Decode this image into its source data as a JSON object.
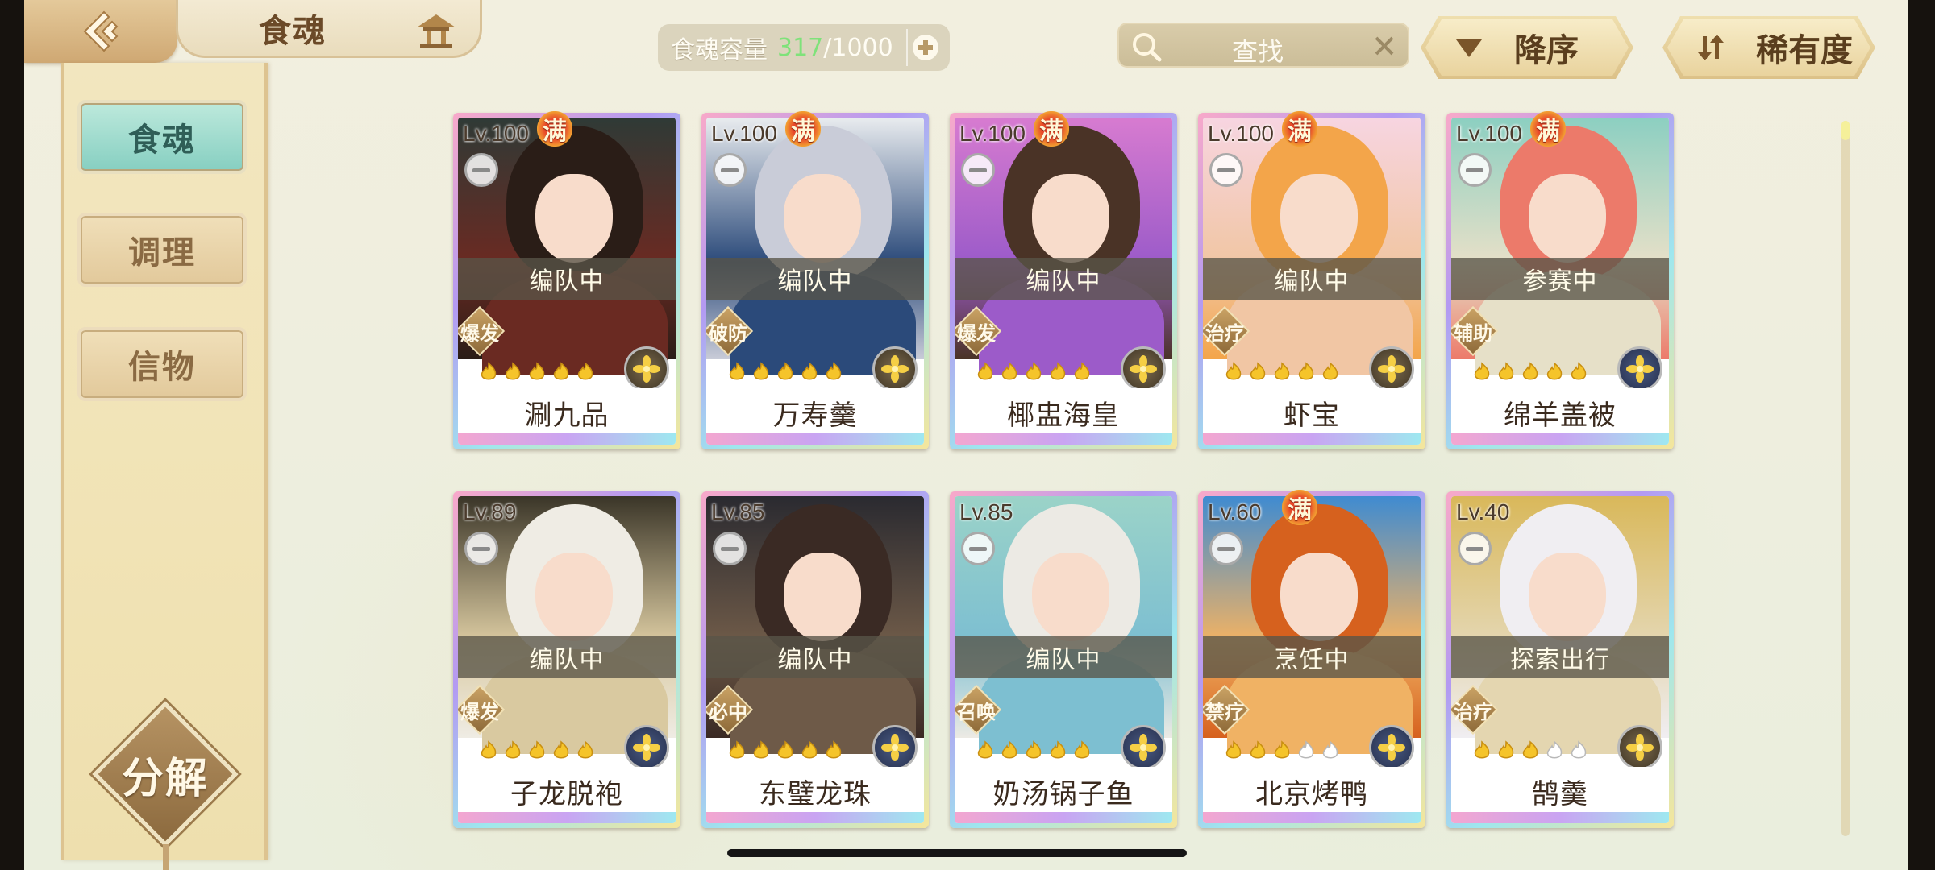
{
  "header": {
    "title": "食魂",
    "capacity_label": "食魂容量",
    "capacity_current": "317",
    "capacity_max": "/1000",
    "search_placeholder": "查找",
    "sort_order_label": "降序",
    "sort_field_label": "稀有度"
  },
  "sidebar": {
    "tabs": [
      {
        "label": "食魂",
        "active": true
      },
      {
        "label": "调理",
        "active": false
      },
      {
        "label": "信物",
        "active": false
      }
    ],
    "decompose_label": "分解"
  },
  "cards": [
    {
      "level": "Lv.100",
      "max": "满",
      "status": "编队中",
      "role": "爆发",
      "stars_filled": 5,
      "element": "gold",
      "name": "涮九品",
      "palette": [
        "#2a1d17",
        "#6a2a22",
        "#2f3a36"
      ]
    },
    {
      "level": "Lv.100",
      "max": "满",
      "status": "编队中",
      "role": "破防",
      "stars_filled": 5,
      "element": "gold",
      "name": "万寿羹",
      "palette": [
        "#c9ccd8",
        "#2b4a7a",
        "#e9ecef"
      ]
    },
    {
      "level": "Lv.100",
      "max": "满",
      "status": "编队中",
      "role": "爆发",
      "stars_filled": 5,
      "element": "gold",
      "name": "椰盅海皇",
      "palette": [
        "#4a3326",
        "#9c5bc9",
        "#d77bd0"
      ]
    },
    {
      "level": "Lv.100",
      "max": "满",
      "status": "编队中",
      "role": "治疗",
      "stars_filled": 5,
      "element": "gold",
      "name": "虾宝",
      "palette": [
        "#f3a54a",
        "#f1c6a4",
        "#f7d5e1"
      ]
    },
    {
      "level": "Lv.100",
      "max": "满",
      "status": "参赛中",
      "role": "辅助",
      "stars_filled": 5,
      "element": "navy",
      "name": "绵羊盖被",
      "palette": [
        "#ec7a6a",
        "#e6e0c8",
        "#8ccfc1"
      ]
    },
    {
      "level": "Lv.89",
      "max": "",
      "status": "编队中",
      "role": "爆发",
      "stars_filled": 5,
      "element": "navy",
      "name": "子龙脱袍",
      "palette": [
        "#efece4",
        "#d9c9a0",
        "#3a3528"
      ]
    },
    {
      "level": "Lv.85",
      "max": "",
      "status": "编队中",
      "role": "必中",
      "stars_filled": 5,
      "element": "navy",
      "name": "东璧龙珠",
      "palette": [
        "#3a2a24",
        "#6e5a48",
        "#2a2a30"
      ]
    },
    {
      "level": "Lv.85",
      "max": "",
      "status": "编队中",
      "role": "召唤",
      "stars_filled": 5,
      "element": "navy",
      "name": "奶汤锅子鱼",
      "palette": [
        "#eceae4",
        "#7dbfd1",
        "#9bd3c8"
      ]
    },
    {
      "level": "Lv.60",
      "max": "满",
      "status": "烹饪中",
      "role": "禁疗",
      "stars_filled": 3,
      "element": "navy",
      "name": "北京烤鸭",
      "palette": [
        "#d6611e",
        "#f0b264",
        "#3f8bd1"
      ]
    },
    {
      "level": "Lv.40",
      "max": "",
      "status": "探索出行",
      "role": "治疗",
      "stars_filled": 3,
      "element": "gold",
      "name": "鹄羹",
      "palette": [
        "#f0eef2",
        "#e4d6b0",
        "#d9b85a"
      ]
    }
  ],
  "colors": {
    "accent_teal": "#86cfc1",
    "gold_trim": "#dcc188",
    "capacity_current": "#7fe27a"
  },
  "icons": {
    "back": "back-arrow-icon",
    "home": "pavilion-icon",
    "search": "search-icon",
    "clear": "close-icon",
    "sort_order": "triangle-down-icon",
    "sort_field": "sort-arrows-icon",
    "add": "plus-icon",
    "star": "flame-star-icon",
    "element": "flower-element-icon"
  }
}
